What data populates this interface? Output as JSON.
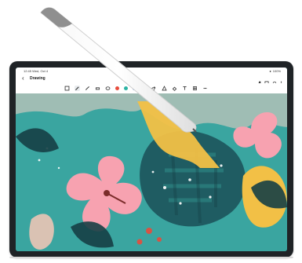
{
  "status": {
    "time": "12:45 Wed, Oct 4",
    "battery": "100%"
  },
  "app": {
    "title": "Drawing"
  },
  "toolbar": {
    "colors": [
      "#e74c3c",
      "#2bb3a3",
      "#1f5fbf"
    ],
    "tools": [
      {
        "name": "layers-icon"
      },
      {
        "name": "pen-icon"
      },
      {
        "name": "brush-icon"
      },
      {
        "name": "eraser-icon"
      },
      {
        "name": "lasso-icon"
      },
      {
        "name": "undo-icon"
      },
      {
        "name": "redo-icon"
      },
      {
        "name": "shape-icon"
      },
      {
        "name": "fill-icon"
      },
      {
        "name": "text-icon"
      },
      {
        "name": "grid-icon"
      },
      {
        "name": "more-icon"
      }
    ]
  },
  "artwork": {
    "description": "Tropical leaves and hibiscus flowers illustration"
  }
}
